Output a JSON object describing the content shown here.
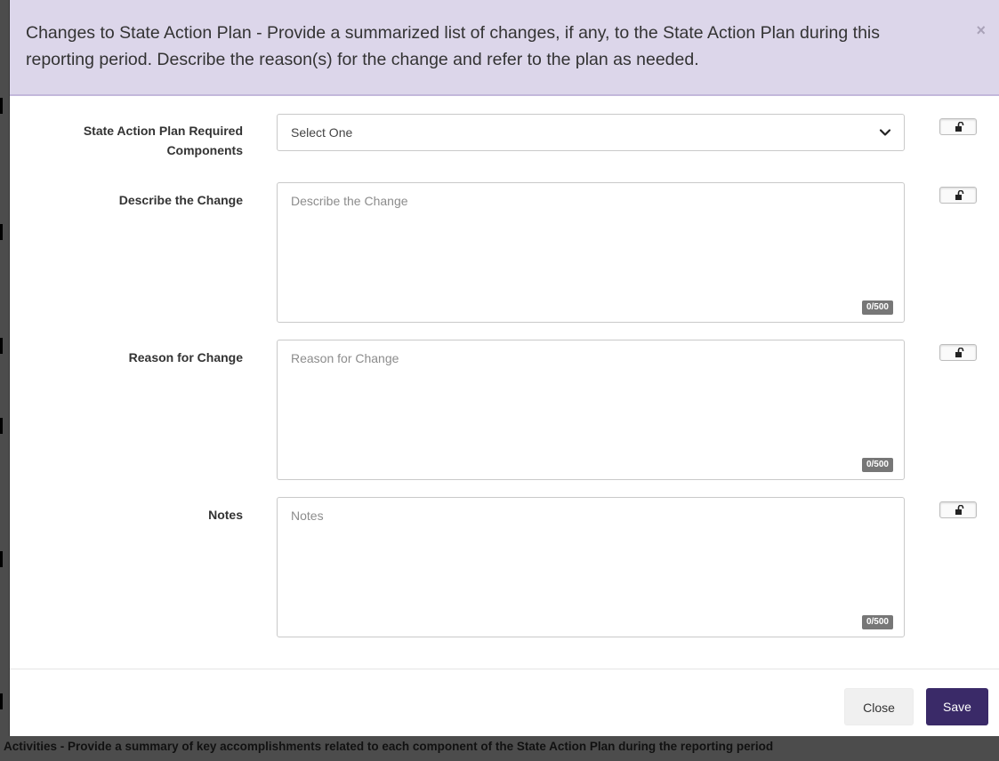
{
  "modal": {
    "title": "Changes to State Action Plan - Provide a summarized list of changes, if any, to the State Action Plan during this reporting period. Describe the reason(s) for the change and refer to the plan as needed.",
    "close_icon": "×"
  },
  "form": {
    "components": {
      "label": "State Action Plan Required Components",
      "selected": "Select One"
    },
    "describe": {
      "label": "Describe the Change",
      "placeholder": "Describe the Change",
      "counter": "0/500"
    },
    "reason": {
      "label": "Reason for Change",
      "placeholder": "Reason for Change",
      "counter": "0/500"
    },
    "notes": {
      "label": "Notes",
      "placeholder": "Notes",
      "counter": "0/500"
    }
  },
  "footer": {
    "close_label": "Close",
    "save_label": "Save"
  },
  "background": {
    "bottom_text": "Activities - Provide a summary of key accomplishments related to each component of the State Action Plan during the reporting period"
  },
  "colors": {
    "header_bg": "#dcd6ea",
    "save_bg": "#3a2a68",
    "overlay": "#4c4c4c"
  },
  "icons": {
    "lock": "unlock-icon",
    "chevron": "chevron-down-icon",
    "close": "close-icon"
  }
}
